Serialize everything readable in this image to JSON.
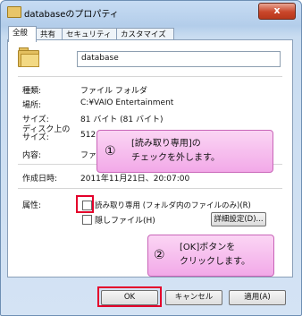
{
  "window": {
    "title": "databaseのプロパティ",
    "close_label": "x"
  },
  "tabs": [
    "全般",
    "共有",
    "セキュリティ",
    "カスタマイズ"
  ],
  "name_field": {
    "value": "database"
  },
  "rows": [
    {
      "label": "種類:",
      "value": "ファイル フォルダ"
    },
    {
      "label": "場所:",
      "value": "C:¥VAIO Entertainment"
    },
    {
      "label": "サイズ:",
      "value": "81 バイト (81 バイト)"
    },
    {
      "label": "ディスク上のサイズ:",
      "value": "512 バイト (5"
    },
    {
      "label": "内容:",
      "value": "ファイル数: 1"
    },
    {
      "label": "作成日時:",
      "value": "2011年11月21日、20:07:00"
    }
  ],
  "attributes": {
    "label": "属性:",
    "readonly": "読み取り専用 (フォルダ内のファイルのみ)(R)",
    "hidden": "隠しファイル(H)",
    "advanced_button": "詳細設定(D)..."
  },
  "buttons": {
    "ok": "OK",
    "cancel": "キャンセル",
    "apply": "適用(A)"
  },
  "callouts": [
    {
      "num": "①",
      "line1": "[読み取り専用]の",
      "line2": "チェックを外します。"
    },
    {
      "num": "②",
      "line1": "[OK]ボタンを",
      "line2": "クリックします。"
    }
  ],
  "colors": {
    "callout": "#f6bdeb",
    "highlight": "#e4002b"
  }
}
